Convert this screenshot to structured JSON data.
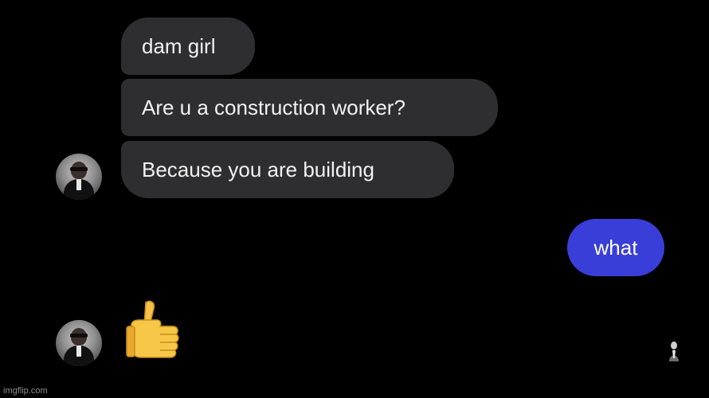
{
  "messages": {
    "incoming": [
      {
        "text": "dam girl"
      },
      {
        "text": "Are u a construction worker?"
      },
      {
        "text": "Because you are building"
      }
    ],
    "outgoing": [
      {
        "text": "what"
      }
    ],
    "reaction": {
      "emoji": "thumbs-up-emoji"
    }
  },
  "colors": {
    "background": "#000000",
    "incoming_bubble": "#2e2e30",
    "outgoing_bubble": "#3a3ed8",
    "text": "#f2f2f2"
  },
  "watermark": {
    "text": "imgflip.com"
  }
}
